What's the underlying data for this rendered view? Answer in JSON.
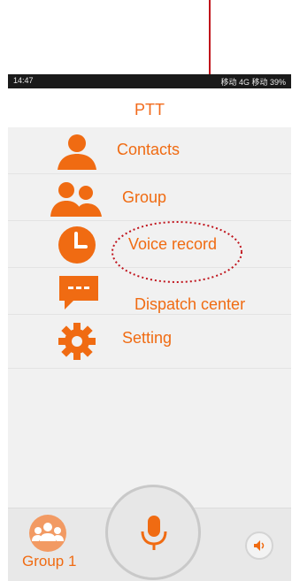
{
  "status_bar": {
    "time": "14:47",
    "indicators": "移动 4G  移动  39%"
  },
  "app": {
    "title": "PTT"
  },
  "menu": [
    {
      "label": "Contacts",
      "icon": "person-icon"
    },
    {
      "label": "Group",
      "icon": "group-icon"
    },
    {
      "label": "Voice record",
      "icon": "clock-icon"
    },
    {
      "label": "Dispatch center",
      "icon": "chat-bubble-icon"
    },
    {
      "label": "Setting",
      "icon": "gear-icon"
    }
  ],
  "bottom_bar": {
    "group_label": "Group 1"
  },
  "colors": {
    "accent": "#f06b12",
    "annotation": "#c0141c"
  }
}
